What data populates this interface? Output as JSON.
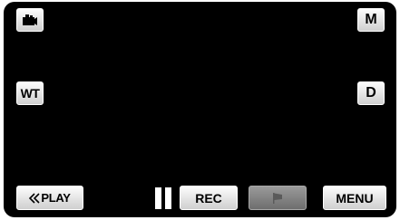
{
  "controls": {
    "wt_label": "WT",
    "m_label": "M",
    "d_label": "D",
    "play_label": "PLAY",
    "rec_label": "REC",
    "menu_label": "MENU"
  },
  "icons": {
    "mode": "video-camera-icon",
    "play_chevron": "double-chevron-left-icon",
    "pause": "pause-icon",
    "flag": "flag-icon"
  },
  "colors": {
    "background": "#000000",
    "button": "#e8e8e8",
    "button_disabled": "#8a8a8a"
  }
}
